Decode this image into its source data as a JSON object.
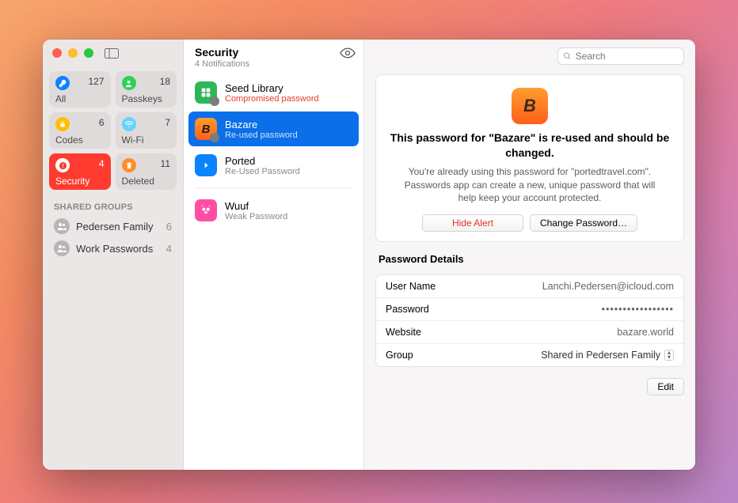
{
  "sidebar": {
    "cards": [
      {
        "id": "all",
        "label": "All",
        "count": 127,
        "icon": "key-icon"
      },
      {
        "id": "passkeys",
        "label": "Passkeys",
        "count": 18,
        "icon": "person-icon"
      },
      {
        "id": "codes",
        "label": "Codes",
        "count": 6,
        "icon": "lock-icon"
      },
      {
        "id": "wifi",
        "label": "Wi-Fi",
        "count": 7,
        "icon": "wifi-icon"
      },
      {
        "id": "security",
        "label": "Security",
        "count": 4,
        "icon": "exclaim-icon",
        "active": true
      },
      {
        "id": "deleted",
        "label": "Deleted",
        "count": 11,
        "icon": "trash-icon"
      }
    ],
    "shared_header": "SHARED GROUPS",
    "groups": [
      {
        "label": "Pedersen Family",
        "count": 6
      },
      {
        "label": "Work Passwords",
        "count": 4
      }
    ]
  },
  "middle": {
    "title": "Security",
    "subtitle": "4 Notifications",
    "items": [
      {
        "name": "Seed Library",
        "sub": "Compromised password",
        "icon_bg": "#2eb65a",
        "warn": true,
        "badge": true
      },
      {
        "name": "Bazare",
        "sub": "Re-used password",
        "icon_bg": "linear-gradient(#ff9d2f,#ff5e1a)",
        "selected": true,
        "badge": true
      },
      {
        "name": "Ported",
        "sub": "Re-Used Password",
        "icon_bg": "#0a84ff"
      },
      {
        "name": "Wuuf",
        "sub": "Weak Password",
        "icon_bg": "#ff4ea3"
      }
    ]
  },
  "detail": {
    "search_placeholder": "Search",
    "alert_title": "This password for \"Bazare\" is re-used and should be changed.",
    "alert_body": "You're already using this password for \"portedtravel.com\". Passwords app can create a new, unique password that will help keep your account protected.",
    "hide_btn": "Hide Alert",
    "change_btn": "Change Password…",
    "details_header": "Password Details",
    "rows": {
      "username_k": "User Name",
      "username_v": "Lanchi.Pedersen@icloud.com",
      "password_k": "Password",
      "password_v": "•••••••••••••••••",
      "website_k": "Website",
      "website_v": "bazare.world",
      "group_k": "Group",
      "group_v": "Shared in Pedersen Family"
    },
    "edit_btn": "Edit"
  }
}
